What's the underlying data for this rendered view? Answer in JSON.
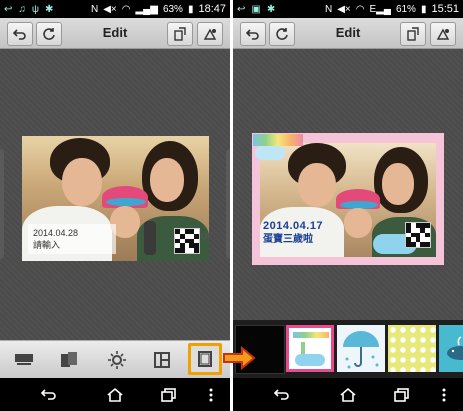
{
  "left_screen": {
    "status": {
      "battery": "63%",
      "time": "18:47"
    },
    "header": {
      "title": "Edit"
    },
    "photo": {
      "date": "2014.04.28",
      "caption": "請輸入",
      "qr_label": "QR"
    }
  },
  "right_screen": {
    "status": {
      "battery": "61%",
      "time": "15:51"
    },
    "header": {
      "title": "Edit"
    },
    "photo": {
      "date": "2014.04.17",
      "caption": "蛋寶三歲啦"
    }
  },
  "toolbar": {
    "tools": [
      "text-layout-icon",
      "sticker-icon",
      "brightness-icon",
      "layout-grid-icon",
      "frame-icon"
    ],
    "active_tool": "frame-icon"
  },
  "frame_thumbnails": [
    "blank-frame",
    "rainbow-cloud-frame",
    "umbrella-frame",
    "polka-dot-frame",
    "whale-frame"
  ],
  "colors": {
    "accent": "#f0a000",
    "frame_highlight": "#e94b8b",
    "date_blue": "#1c3f96"
  }
}
